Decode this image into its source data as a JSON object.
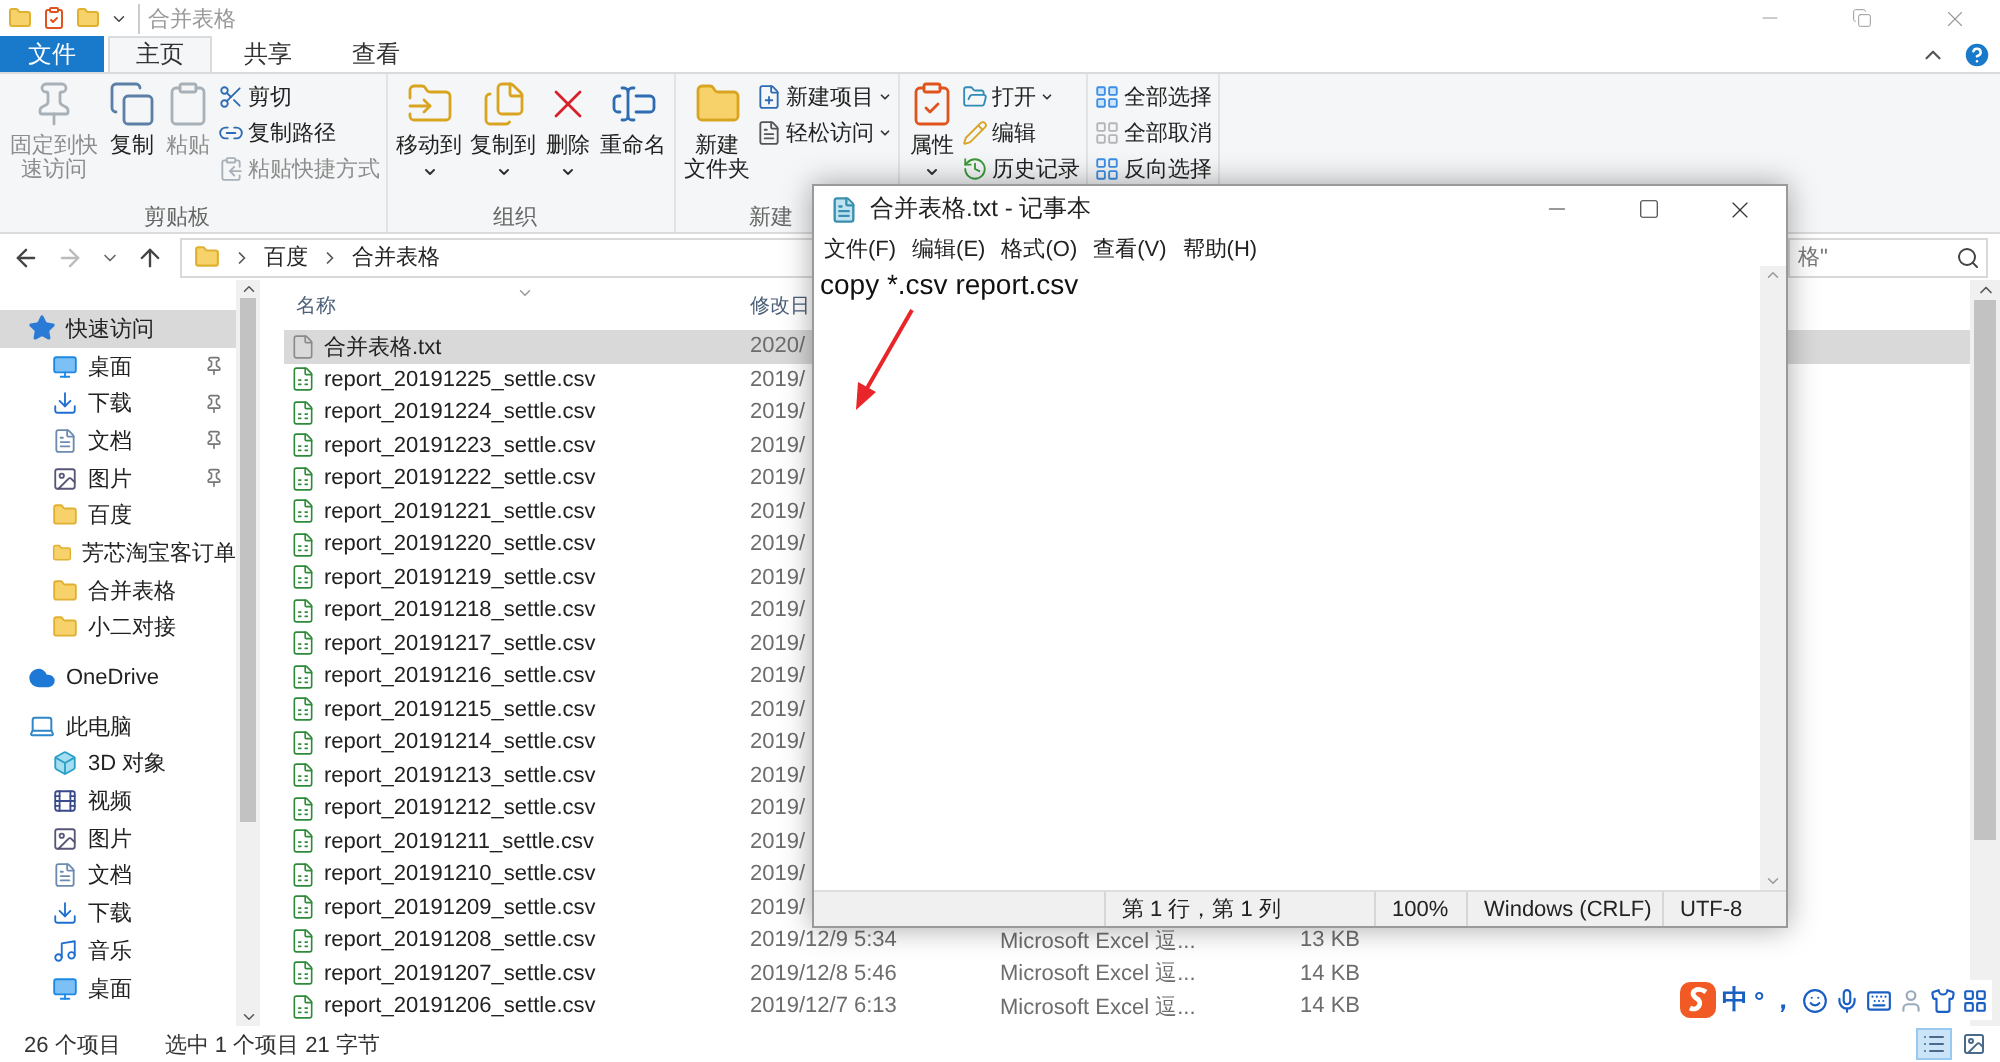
{
  "explorer": {
    "title": "合并表格",
    "tabs": [
      {
        "label": "文件",
        "kind": "file",
        "selected": false
      },
      {
        "label": "主页",
        "kind": "tab",
        "selected": true
      },
      {
        "label": "共享",
        "kind": "tab",
        "selected": false
      },
      {
        "label": "查看",
        "kind": "tab",
        "selected": false
      }
    ],
    "ribbon": [
      {
        "label": "剪贴板",
        "large": [
          {
            "label": "固定到快速访问",
            "kind": "pin",
            "disabled": true,
            "dropdown": false
          },
          {
            "label": "复制",
            "kind": "copy",
            "disabled": false,
            "dropdown": false
          },
          {
            "label": "粘贴",
            "kind": "paste",
            "disabled": true,
            "dropdown": false
          }
        ],
        "small": [
          {
            "label": "剪切",
            "kind": "cut",
            "disabled": false,
            "dropdown": false
          },
          {
            "label": "复制路径",
            "kind": "copy-path",
            "disabled": false,
            "dropdown": false
          },
          {
            "label": "粘贴快捷方式",
            "kind": "paste-shortcut",
            "disabled": true,
            "dropdown": false
          }
        ]
      },
      {
        "label": "组织",
        "large": [
          {
            "label": "移动到",
            "kind": "move-to",
            "disabled": false,
            "dropdown": true
          },
          {
            "label": "复制到",
            "kind": "copy-to",
            "disabled": false,
            "dropdown": true
          },
          {
            "label": "删除",
            "kind": "delete",
            "disabled": false,
            "dropdown": true
          },
          {
            "label": "重命名",
            "kind": "rename",
            "disabled": false,
            "dropdown": false
          }
        ]
      },
      {
        "label": "新建",
        "large": [
          {
            "label": [
              "新建",
              "文件夹"
            ],
            "kind": "new-folder",
            "disabled": false,
            "dropdown": false
          }
        ],
        "small": [
          {
            "label": "新建项目",
            "kind": "new-item",
            "disabled": false,
            "dropdown": true
          },
          {
            "label": "轻松访问",
            "kind": "easy-access",
            "disabled": false,
            "dropdown": true
          }
        ]
      },
      {
        "large": [
          {
            "label": "属性",
            "kind": "properties",
            "disabled": false,
            "dropdown": true
          }
        ],
        "small": [
          {
            "label": "打开",
            "kind": "open",
            "disabled": false,
            "dropdown": true
          },
          {
            "label": "编辑",
            "kind": "edit",
            "disabled": false,
            "dropdown": false
          },
          {
            "label": "历史记录",
            "kind": "history",
            "disabled": false,
            "dropdown": false
          }
        ]
      },
      {
        "small": [
          {
            "label": "全部选择",
            "kind": "select-all",
            "disabled": false,
            "dropdown": false
          },
          {
            "label": "全部取消",
            "kind": "select-none",
            "disabled": false,
            "dropdown": false
          },
          {
            "label": "反向选择",
            "kind": "invert",
            "disabled": false,
            "dropdown": false
          }
        ]
      }
    ],
    "address": {
      "path": [
        "百度",
        "合并表格"
      ],
      "search_placeholder": "格\""
    },
    "sidebar": [
      {
        "label": "快速访问",
        "kind": "star",
        "selected": true,
        "children": [
          {
            "label": "桌面",
            "kind": "desktop",
            "pinned": true,
            "selected": false
          },
          {
            "label": "下载",
            "kind": "download",
            "pinned": true,
            "selected": false
          },
          {
            "label": "文档",
            "kind": "documents",
            "pinned": true,
            "selected": false
          },
          {
            "label": "图片",
            "kind": "pictures",
            "pinned": true,
            "selected": false
          },
          {
            "label": "百度",
            "kind": "folder",
            "pinned": false,
            "selected": false
          },
          {
            "label": "芳芯淘宝客订单",
            "kind": "folder",
            "pinned": false,
            "selected": false
          },
          {
            "label": "合并表格",
            "kind": "folder",
            "pinned": false,
            "selected": false
          },
          {
            "label": "小二对接",
            "kind": "folder",
            "pinned": false,
            "selected": false
          }
        ]
      },
      {
        "label": "OneDrive",
        "kind": "cloud",
        "selected": false
      },
      {
        "label": "此电脑",
        "kind": "pc",
        "selected": false,
        "children": [
          {
            "label": "3D 对象",
            "kind": "cube",
            "selected": false
          },
          {
            "label": "视频",
            "kind": "video",
            "selected": false
          },
          {
            "label": "图片",
            "kind": "pictures",
            "selected": false
          },
          {
            "label": "文档",
            "kind": "documents",
            "selected": false
          },
          {
            "label": "下载",
            "kind": "download",
            "selected": false
          },
          {
            "label": "音乐",
            "kind": "music",
            "selected": false
          },
          {
            "label": "桌面",
            "kind": "desktop",
            "selected": false
          }
        ]
      }
    ],
    "files": {
      "columns": [
        {
          "label": "名称"
        },
        {
          "label": "修改日"
        }
      ],
      "rows": [
        {
          "name": "合并表格.txt",
          "kind": "text",
          "date": "2020/",
          "selected": true
        },
        {
          "name": "report_20191225_settle.csv",
          "kind": "spreadsheet",
          "date": "2019/",
          "selected": false
        },
        {
          "name": "report_20191224_settle.csv",
          "kind": "spreadsheet",
          "date": "2019/",
          "selected": false
        },
        {
          "name": "report_20191223_settle.csv",
          "kind": "spreadsheet",
          "date": "2019/",
          "selected": false
        },
        {
          "name": "report_20191222_settle.csv",
          "kind": "spreadsheet",
          "date": "2019/",
          "selected": false
        },
        {
          "name": "report_20191221_settle.csv",
          "kind": "spreadsheet",
          "date": "2019/",
          "selected": false
        },
        {
          "name": "report_20191220_settle.csv",
          "kind": "spreadsheet",
          "date": "2019/",
          "selected": false
        },
        {
          "name": "report_20191219_settle.csv",
          "kind": "spreadsheet",
          "date": "2019/",
          "selected": false
        },
        {
          "name": "report_20191218_settle.csv",
          "kind": "spreadsheet",
          "date": "2019/",
          "selected": false
        },
        {
          "name": "report_20191217_settle.csv",
          "kind": "spreadsheet",
          "date": "2019/",
          "selected": false
        },
        {
          "name": "report_20191216_settle.csv",
          "kind": "spreadsheet",
          "date": "2019/",
          "selected": false
        },
        {
          "name": "report_20191215_settle.csv",
          "kind": "spreadsheet",
          "date": "2019/",
          "selected": false
        },
        {
          "name": "report_20191214_settle.csv",
          "kind": "spreadsheet",
          "date": "2019/",
          "selected": false
        },
        {
          "name": "report_20191213_settle.csv",
          "kind": "spreadsheet",
          "date": "2019/",
          "selected": false
        },
        {
          "name": "report_20191212_settle.csv",
          "kind": "spreadsheet",
          "date": "2019/",
          "selected": false
        },
        {
          "name": "report_20191211_settle.csv",
          "kind": "spreadsheet",
          "date": "2019/",
          "selected": false
        },
        {
          "name": "report_20191210_settle.csv",
          "kind": "spreadsheet",
          "date": "2019/",
          "selected": false
        },
        {
          "name": "report_20191209_settle.csv",
          "kind": "spreadsheet",
          "date": "2019/",
          "selected": false
        },
        {
          "name": "report_20191208_settle.csv",
          "kind": "spreadsheet",
          "date": "2019/12/9 5:34",
          "type": "Microsoft Excel 逗...",
          "size": "13 KB",
          "selected": false
        },
        {
          "name": "report_20191207_settle.csv",
          "kind": "spreadsheet",
          "date": "2019/12/8 5:46",
          "type": "Microsoft Excel 逗...",
          "size": "14 KB",
          "selected": false
        },
        {
          "name": "report_20191206_settle.csv",
          "kind": "spreadsheet",
          "date": "2019/12/7 6:13",
          "type": "Microsoft Excel 逗...",
          "size": "14 KB",
          "selected": false
        }
      ]
    },
    "status": {
      "count": "26 个项目",
      "selection": "选中 1 个项目  21 字节"
    },
    "views": [
      {
        "kind": "details",
        "selected": true
      },
      {
        "kind": "large-icons",
        "selected": false
      }
    ]
  },
  "notepad": {
    "title": "合并表格.txt - 记事本",
    "menu": [
      "文件(F)",
      "编辑(E)",
      "格式(O)",
      "查看(V)",
      "帮助(H)"
    ],
    "content": "copy *.csv report.csv",
    "annotations": [
      {
        "kind": "arrow"
      }
    ],
    "status": [
      "第 1 行，第 1 列",
      "100%",
      "Windows (CRLF)",
      "UTF-8"
    ]
  },
  "ime_toolbar": [
    {
      "kind": "logo"
    },
    {
      "kind": "text",
      "label": "中"
    },
    {
      "kind": "text",
      "label": "°"
    },
    {
      "kind": "text",
      "label": "，"
    },
    {
      "kind": "emoji"
    },
    {
      "kind": "voice"
    },
    {
      "kind": "keyboard"
    },
    {
      "kind": "user"
    },
    {
      "kind": "skin"
    },
    {
      "kind": "tools"
    }
  ]
}
